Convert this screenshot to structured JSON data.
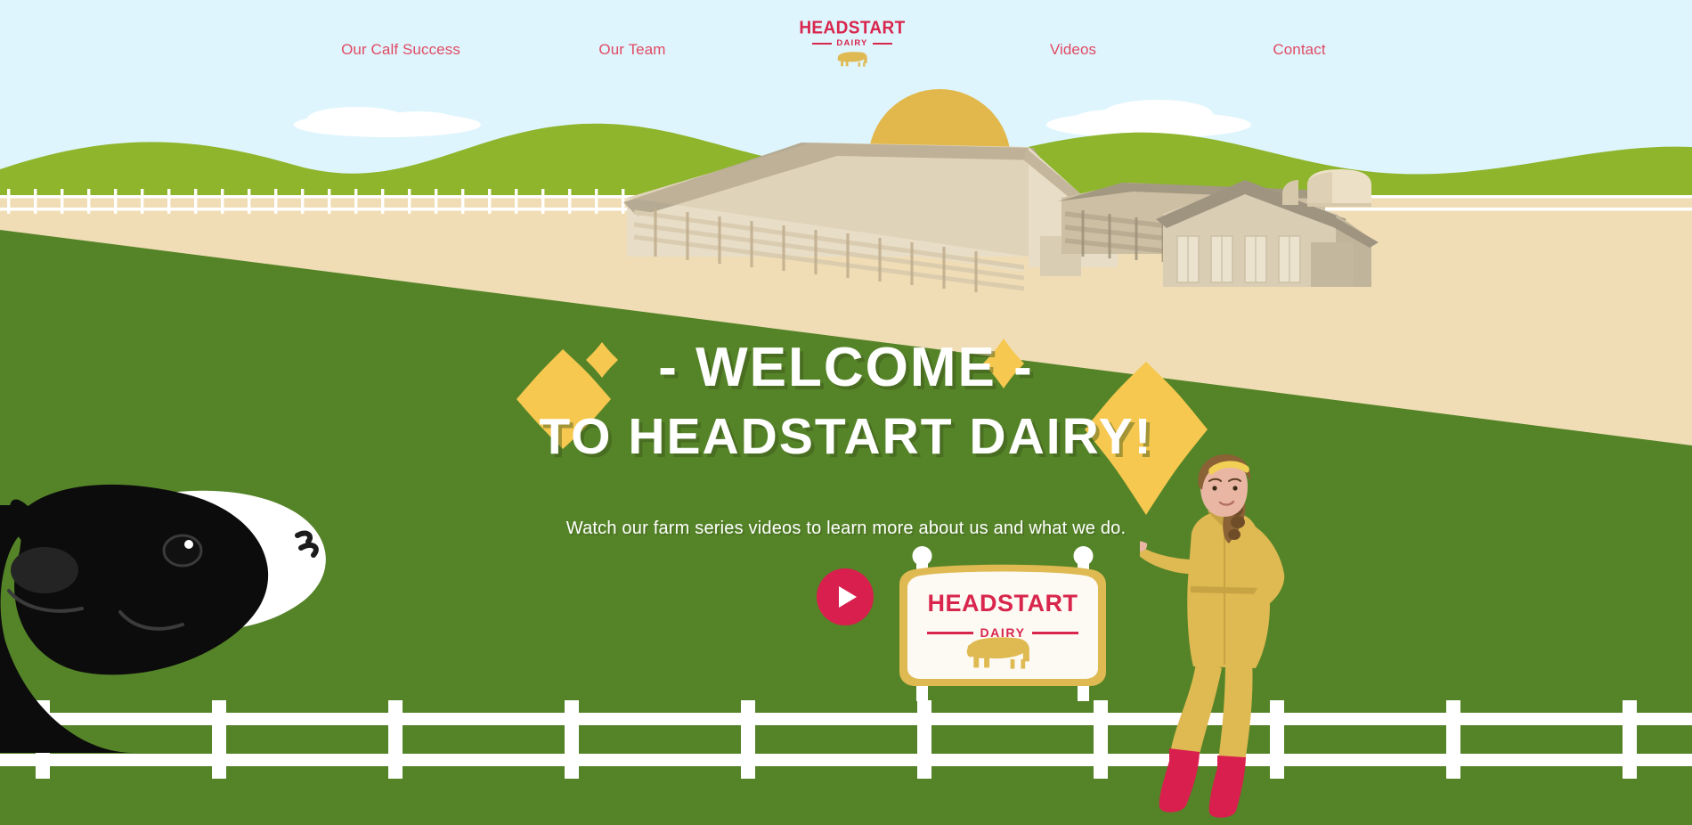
{
  "page": {
    "title": "Headstart Dairy",
    "colors": {
      "sky": "#dff5fd",
      "hill_green": "#8eb52c",
      "field_green": "#558428",
      "sand": "#f0ddb5",
      "sun": "#e2b84c",
      "brand_red": "#d8264d",
      "nav_link": "#e04a63",
      "sparkle_yellow": "#f7c84f",
      "barn_roof": "#b5aa93",
      "barn_wall": "#e8ddc6",
      "boot_red": "#d81f4d",
      "coverall_gold": "#dfb952",
      "white": "#ffffff"
    }
  },
  "nav": {
    "links_left": [
      {
        "label": "Our Calf Success"
      },
      {
        "label": "Our Team"
      }
    ],
    "links_right": [
      {
        "label": "Videos"
      },
      {
        "label": "Contact"
      }
    ]
  },
  "logo": {
    "word": "HEADSTART",
    "sub": "DAIRY",
    "icon": "cow-icon"
  },
  "hero": {
    "headline_line1": "- WELCOME -",
    "headline_line2": "TO HEADSTART DAIRY!",
    "subtitle": "Watch our farm series videos to learn more about us and what we do."
  },
  "play_button": {
    "icon": "play-icon",
    "label": "Play video"
  },
  "farm_sign": {
    "word": "HEADSTART",
    "sub": "DAIRY",
    "icon": "cow-icon"
  },
  "scene": {
    "sun": "sun-shape",
    "clouds": 2,
    "hills": "rolling-hills",
    "fence_background": "white-picket-fence",
    "fence_foreground": "white-rail-fence",
    "buildings": [
      "large-barn",
      "side-barn",
      "farmhouse",
      "silo"
    ],
    "cow": "holstein-cow-head",
    "farmer": "farmer-woman-illustration",
    "sparkles": 4
  }
}
